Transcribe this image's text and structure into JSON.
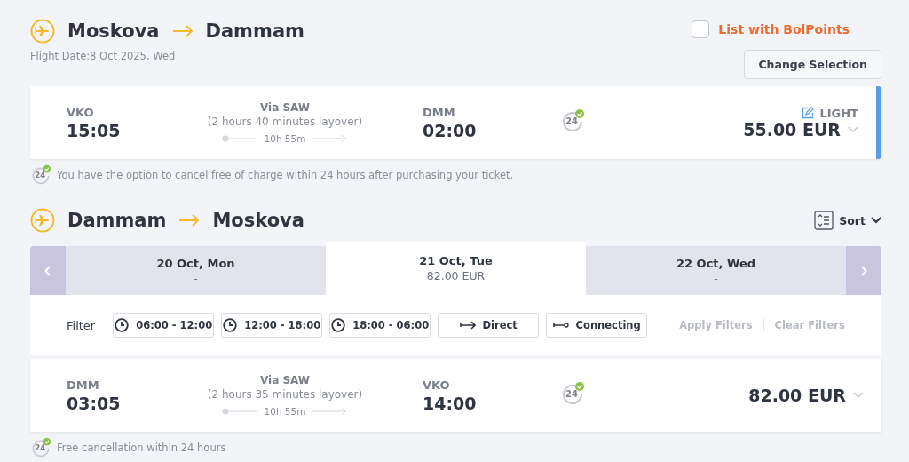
{
  "outbound": {
    "from": "Moskova",
    "to": "Dammam",
    "date": "Flight Date:8 Oct 2025, Wed",
    "bolpoints": {
      "label": "List with BolPoints",
      "checked": false
    },
    "change_button": "Change Selection",
    "flight": {
      "dep_code": "VKO",
      "dep_time": "15:05",
      "via": "Via SAW",
      "layover": "(2 hours 40 minutes layover)",
      "duration": "10h 55m",
      "arr_code": "DMM",
      "arr_time": "02:00",
      "badge": "24",
      "fare": "LIGHT",
      "price": "55.00 EUR",
      "selected": true
    },
    "note": {
      "badge": "24",
      "text": "You have the option to cancel free of charge within 24 hours after purchasing your ticket."
    }
  },
  "return": {
    "from": "Dammam",
    "to": "Moskova",
    "sort": "Sort",
    "dates": [
      {
        "label": "20 Oct, Mon",
        "price": "-",
        "selected": false
      },
      {
        "label": "21 Oct, Tue",
        "price": "82.00 EUR",
        "selected": true
      },
      {
        "label": "22 Oct, Wed",
        "price": "-",
        "selected": false
      }
    ],
    "filter": {
      "label": "Filter",
      "options": [
        {
          "kind": "time",
          "label": "06:00 - 12:00"
        },
        {
          "kind": "time",
          "label": "12:00 - 18:00"
        },
        {
          "kind": "time",
          "label": "18:00 - 06:00"
        },
        {
          "kind": "direct",
          "label": "Direct"
        },
        {
          "kind": "connecting",
          "label": "Connecting"
        }
      ],
      "actions": [
        {
          "label": "Apply Filters",
          "disabled": true
        },
        {
          "label": "Clear Filters",
          "disabled": true
        }
      ]
    },
    "flight": {
      "dep_code": "DMM",
      "dep_time": "03:05",
      "via": "Via SAW",
      "layover": "(2 hours 35 minutes layover)",
      "duration": "10h 55m",
      "arr_code": "VKO",
      "arr_time": "14:00",
      "badge": "24",
      "price": "82.00 EUR",
      "selected": false
    },
    "note": {
      "badge": "24",
      "text": "Free cancellation within 24 hours"
    }
  }
}
